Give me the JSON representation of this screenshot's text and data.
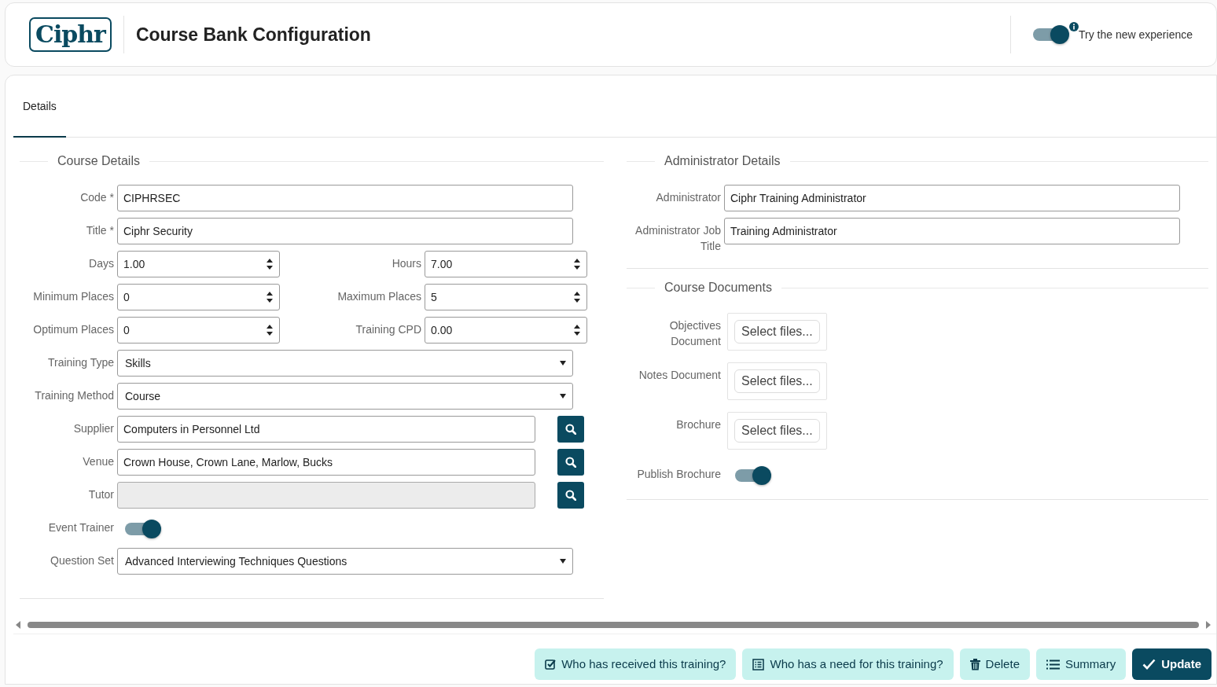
{
  "header": {
    "logo": "Ciphr",
    "title": "Course Bank Configuration",
    "experience": {
      "label": "Try the new experience",
      "on": true
    }
  },
  "tabs": [
    {
      "label": "Details",
      "selected": true
    }
  ],
  "course_details": {
    "title": "Course Details",
    "rows": [
      [
        {
          "kind": "text",
          "label": "Code *",
          "value": "CIPHRSEC"
        }
      ],
      [
        {
          "kind": "text",
          "label": "Title *",
          "value": "Ciphr Security"
        }
      ],
      [
        {
          "kind": "number",
          "label": "Days",
          "value": "1.00"
        },
        {
          "kind": "number",
          "label": "Hours",
          "value": "7.00"
        }
      ],
      [
        {
          "kind": "number",
          "label": "Minimum Places",
          "value": "0"
        },
        {
          "kind": "number",
          "label": "Maximum Places",
          "value": "5"
        }
      ],
      [
        {
          "kind": "number",
          "label": "Optimum Places",
          "value": "0"
        },
        {
          "kind": "number",
          "label": "Training CPD",
          "value": "0.00"
        }
      ],
      [
        {
          "kind": "select",
          "label": "Training Type",
          "value": "Skills"
        }
      ],
      [
        {
          "kind": "select",
          "label": "Training Method",
          "value": "Course"
        }
      ],
      [
        {
          "kind": "lookup",
          "label": "Supplier",
          "value": "Computers in Personnel Ltd",
          "disabled": false
        }
      ],
      [
        {
          "kind": "lookup",
          "label": "Venue",
          "value": "Crown House, Crown Lane, Marlow, Bucks",
          "disabled": false
        }
      ],
      [
        {
          "kind": "lookup",
          "label": "Tutor",
          "disabled": true
        }
      ],
      [
        {
          "kind": "toggle",
          "label": "Event Trainer",
          "on": true
        }
      ],
      [
        {
          "kind": "select",
          "label": "Question Set",
          "value": "Advanced Interviewing Techniques Questions"
        }
      ]
    ]
  },
  "administrator_details": {
    "title": "Administrator Details",
    "fields": [
      {
        "label": "Administrator",
        "value": "Ciphr Training Administrator"
      },
      {
        "label": "Administrator Job Title",
        "value": "Training Administrator"
      }
    ]
  },
  "course_documents": {
    "title": "Course Documents",
    "uploads": [
      {
        "label": "Objectives Document",
        "button": "Select files..."
      },
      {
        "label": "Notes Document",
        "button": "Select files..."
      },
      {
        "label": "Brochure",
        "button": "Select files..."
      }
    ],
    "publish_brochure": {
      "label": "Publish Brochure",
      "on": true
    }
  },
  "actions": [
    {
      "kind": "light",
      "label": "Who has received this training?"
    },
    {
      "kind": "light",
      "label": "Who has a need for this training?"
    },
    {
      "kind": "light",
      "label": "Delete"
    },
    {
      "kind": "light",
      "label": "Summary"
    },
    {
      "kind": "primary",
      "label": "Update"
    }
  ]
}
